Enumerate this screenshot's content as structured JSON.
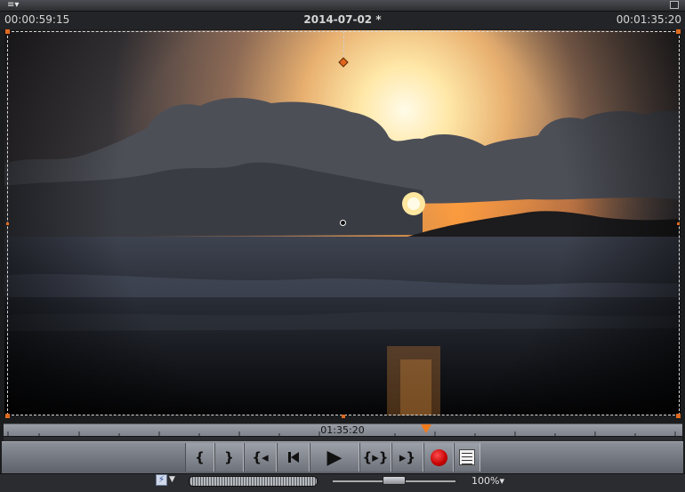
{
  "header": {
    "menu_icon": "≡▾",
    "timecode_left": "00:00:59:15",
    "project_title": "2014-07-02 *",
    "timecode_right": "00:01:35:20"
  },
  "ruler": {
    "timecode": "01:35:20"
  },
  "transport": {
    "mark_in": "{",
    "mark_out": "}",
    "go_to_in": "{◂",
    "play": "▶",
    "play_in_to_out": "{▸}",
    "go_to_out": "▸}"
  },
  "bottom": {
    "zoom_label": "100%▾"
  },
  "colors": {
    "accent": "#e06a1e",
    "record": "#c40000"
  }
}
